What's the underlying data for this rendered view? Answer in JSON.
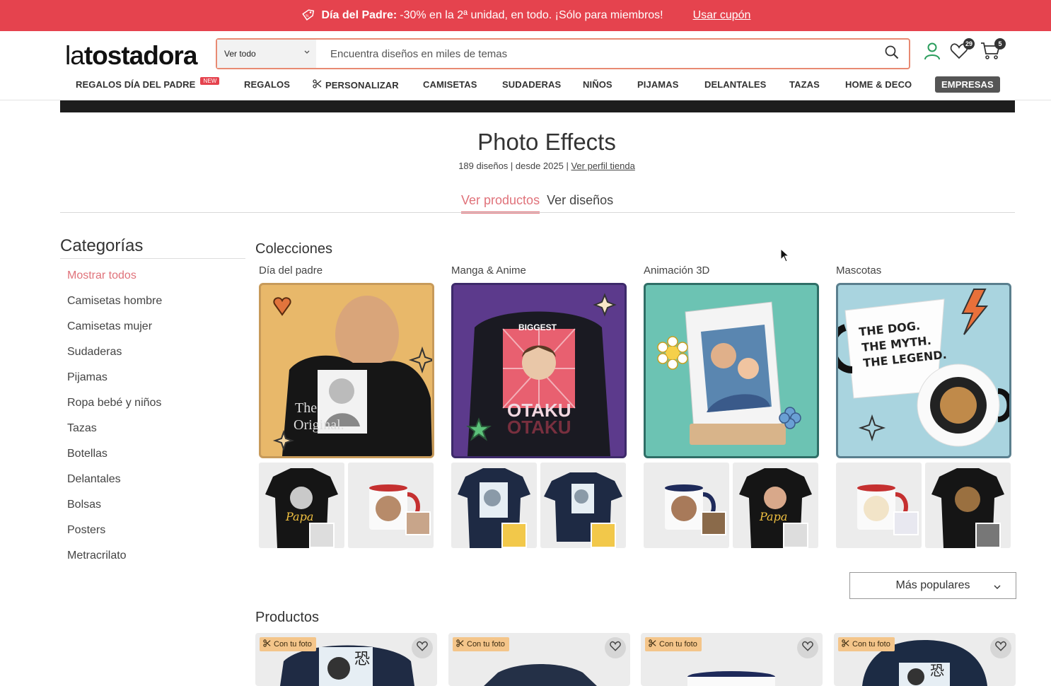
{
  "promo": {
    "bold": "Día del Padre:",
    "text": "-30% en la 2ª unidad, en todo. ¡Sólo para miembros!",
    "coupon": "Usar cupón",
    "icon": "tag-icon"
  },
  "header": {
    "logo_thin": "la",
    "logo_bold": "tostadora",
    "search_category": "Ver todo",
    "search_placeholder": "Encuentra diseños en miles de temas",
    "wishlist_count": "29",
    "cart_count": "5"
  },
  "nav": {
    "items": [
      "REGALOS DÍA DEL PADRE",
      "REGALOS",
      "PERSONALIZAR",
      "CAMISETAS",
      "SUDADERAS",
      "NIÑOS",
      "PIJAMAS",
      "DELANTALES",
      "TAZAS",
      "HOME & DECO",
      "EMPRESAS"
    ],
    "new_badge": "NEW"
  },
  "store": {
    "title": "Photo Effects",
    "meta": "189 diseños | desde 2025 |",
    "profile_link": "Ver perfil tienda",
    "tabs": [
      "Ver productos",
      "Ver diseños"
    ]
  },
  "sidebar": {
    "title": "Categorías",
    "items": [
      "Mostrar todos",
      "Camisetas hombre",
      "Camisetas mujer",
      "Sudaderas",
      "Pijamas",
      "Ropa bebé y niños",
      "Tazas",
      "Botellas",
      "Delantales",
      "Bolsas",
      "Posters",
      "Metracrilato"
    ]
  },
  "collections": {
    "title": "Colecciones",
    "items": [
      {
        "name": "Día del padre",
        "shirt_text": "The Original.",
        "border": "#c79a5a",
        "bg": "#e8b86a"
      },
      {
        "name": "Manga & Anime",
        "shirt_text": "OTAKU",
        "top_text": "BIGGEST",
        "border": "#3d2a6a",
        "bg": "#5c3a8c"
      },
      {
        "name": "Animación 3D",
        "border": "#2f6e66",
        "bg": "#6cc3b3"
      },
      {
        "name": "Mascotas",
        "mug_text": "THE DOG. THE MYTH. THE LEGEND.",
        "border": "#5a7f8e",
        "bg": "#a9d4df"
      }
    ]
  },
  "sort": {
    "label": "Más populares"
  },
  "products": {
    "title": "Productos",
    "label": "Con tu foto",
    "items": [
      {
        "color": "#1f2b44"
      },
      {
        "color": "#243047"
      },
      {
        "color": "#eaeaea"
      },
      {
        "color": "#1c2b44"
      }
    ]
  }
}
